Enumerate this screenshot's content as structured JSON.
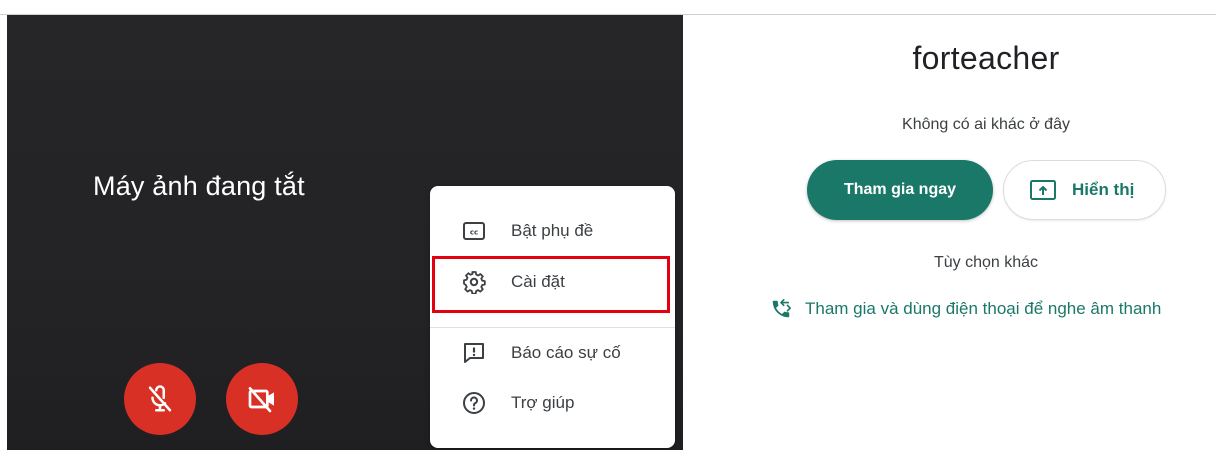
{
  "preview": {
    "camera_status": "Máy ảnh đang tắt",
    "mic_button_icon": "mic-off-icon",
    "camera_button_icon": "videocam-off-icon"
  },
  "menu": {
    "items": [
      {
        "label": "Bật phụ đề",
        "icon": "closed-caption-icon"
      },
      {
        "label": "Cài đặt",
        "icon": "settings-icon"
      },
      {
        "label": "Báo cáo sự cố",
        "icon": "report-problem-icon"
      },
      {
        "label": "Trợ giúp",
        "icon": "help-icon"
      }
    ],
    "highlighted": "Cài đặt"
  },
  "join_panel": {
    "meeting_name": "forteacher",
    "status": "Không có ai khác ở đây",
    "join_label": "Tham gia ngay",
    "present_label": "Hiển thị",
    "present_icon": "present-screen-icon",
    "other_options_label": "Tùy chọn khác",
    "phone_join_label": "Tham gia và dùng điện thoại để nghe âm thanh",
    "phone_icon": "phone-forwarded-icon"
  },
  "colors": {
    "accent": "#1a7868",
    "danger": "#d93025",
    "highlight_border": "#e3000f",
    "preview_bg": "#232325"
  }
}
